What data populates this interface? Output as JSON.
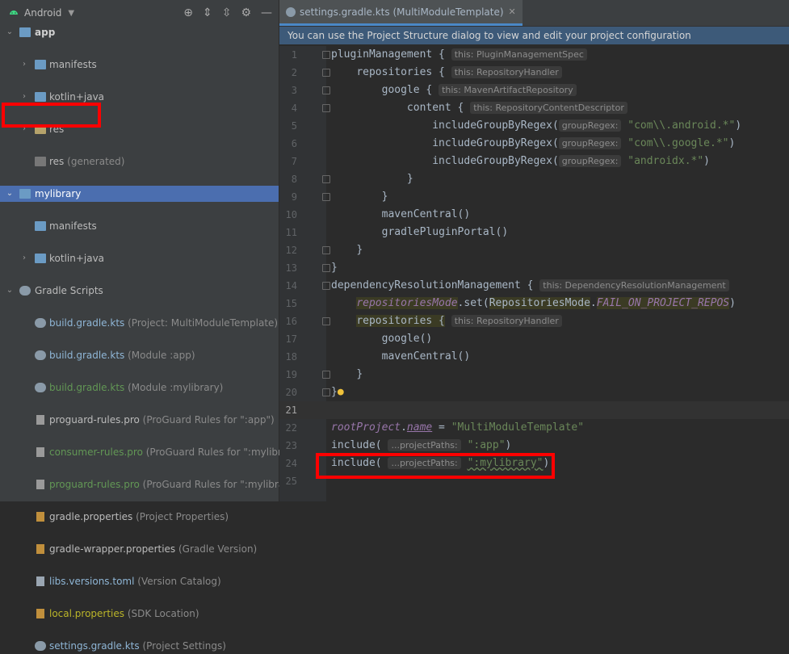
{
  "left_panel": {
    "title": "Android",
    "tree": [
      {
        "label": "app",
        "suffix": ""
      },
      {
        "label": "manifests",
        "suffix": ""
      },
      {
        "label": "kotlin+java",
        "suffix": ""
      },
      {
        "label": "res",
        "suffix": ""
      },
      {
        "label": "res",
        "suffix": "(generated)"
      },
      {
        "label": "mylibrary",
        "suffix": ""
      },
      {
        "label": "manifests",
        "suffix": ""
      },
      {
        "label": "kotlin+java",
        "suffix": ""
      },
      {
        "label": "Gradle Scripts",
        "suffix": ""
      },
      {
        "label": "build.gradle.kts",
        "suffix": "(Project: MultiModuleTemplate)"
      },
      {
        "label": "build.gradle.kts",
        "suffix": "(Module :app)"
      },
      {
        "label": "build.gradle.kts",
        "suffix": "(Module :mylibrary)"
      },
      {
        "label": "proguard-rules.pro",
        "suffix": "(ProGuard Rules for \":app\")"
      },
      {
        "label": "consumer-rules.pro",
        "suffix": "(ProGuard Rules for \":mylibrary\")"
      },
      {
        "label": "proguard-rules.pro",
        "suffix": "(ProGuard Rules for \":mylibrary\")"
      },
      {
        "label": "gradle.properties",
        "suffix": "(Project Properties)"
      },
      {
        "label": "gradle-wrapper.properties",
        "suffix": "(Gradle Version)"
      },
      {
        "label": "libs.versions.toml",
        "suffix": "(Version Catalog)"
      },
      {
        "label": "local.properties",
        "suffix": "(SDK Location)"
      },
      {
        "label": "settings.gradle.kts",
        "suffix": "(Project Settings)"
      }
    ]
  },
  "editor": {
    "tab_label": "settings.gradle.kts (MultiModuleTemplate)",
    "banner": "You can use the Project Structure dialog to view and edit your project configuration",
    "line_numbers": [
      "1",
      "2",
      "3",
      "4",
      "5",
      "6",
      "7",
      "8",
      "9",
      "10",
      "11",
      "12",
      "13",
      "14",
      "15",
      "16",
      "17",
      "18",
      "19",
      "20",
      "21",
      "22",
      "23",
      "24",
      "25"
    ],
    "hints": {
      "h1": "this: PluginManagementSpec",
      "h2": "this: RepositoryHandler",
      "h3": "this: MavenArtifactRepository",
      "h4": "this: RepositoryContentDescriptor",
      "group_regex": "groupRegex:",
      "h14": "this: DependencyResolutionManagement",
      "h16": "this: RepositoryHandler",
      "project_paths": "...projectPaths:"
    },
    "code": {
      "l1": "pluginManagement {",
      "l2": "repositories {",
      "l3": "google {",
      "l4": "content {",
      "regex_fn": "includeGroupByRegex(",
      "s5": "\"com\\\\.android.*\"",
      "s6": "\"com\\\\.google.*\"",
      "s7": "\"androidx.*\"",
      "close_paren": ")",
      "brace": "}",
      "l10": "mavenCentral()",
      "l11": "gradlePluginPortal()",
      "l14": "dependencyResolutionManagement {",
      "l15a": "repositoriesMode",
      "l15b": ".set(",
      "l15c": "RepositoriesMode",
      "l15d": ".",
      "l15e": "FAIL_ON_PROJECT_REPOS",
      "l15f": ")",
      "l16": "repositories {",
      "l17": "google()",
      "l18": "mavenCentral()",
      "l22a": "rootProject",
      "l22b": ".",
      "l22c": "name",
      "l22d": " = ",
      "l22e": "\"MultiModuleTemplate\"",
      "include": "include(",
      "s23": "\":app\"",
      "s24": "\":mylibrary\""
    }
  },
  "colors": {
    "selection": "#4b6eaf",
    "highlight_box": "#ff0000"
  }
}
